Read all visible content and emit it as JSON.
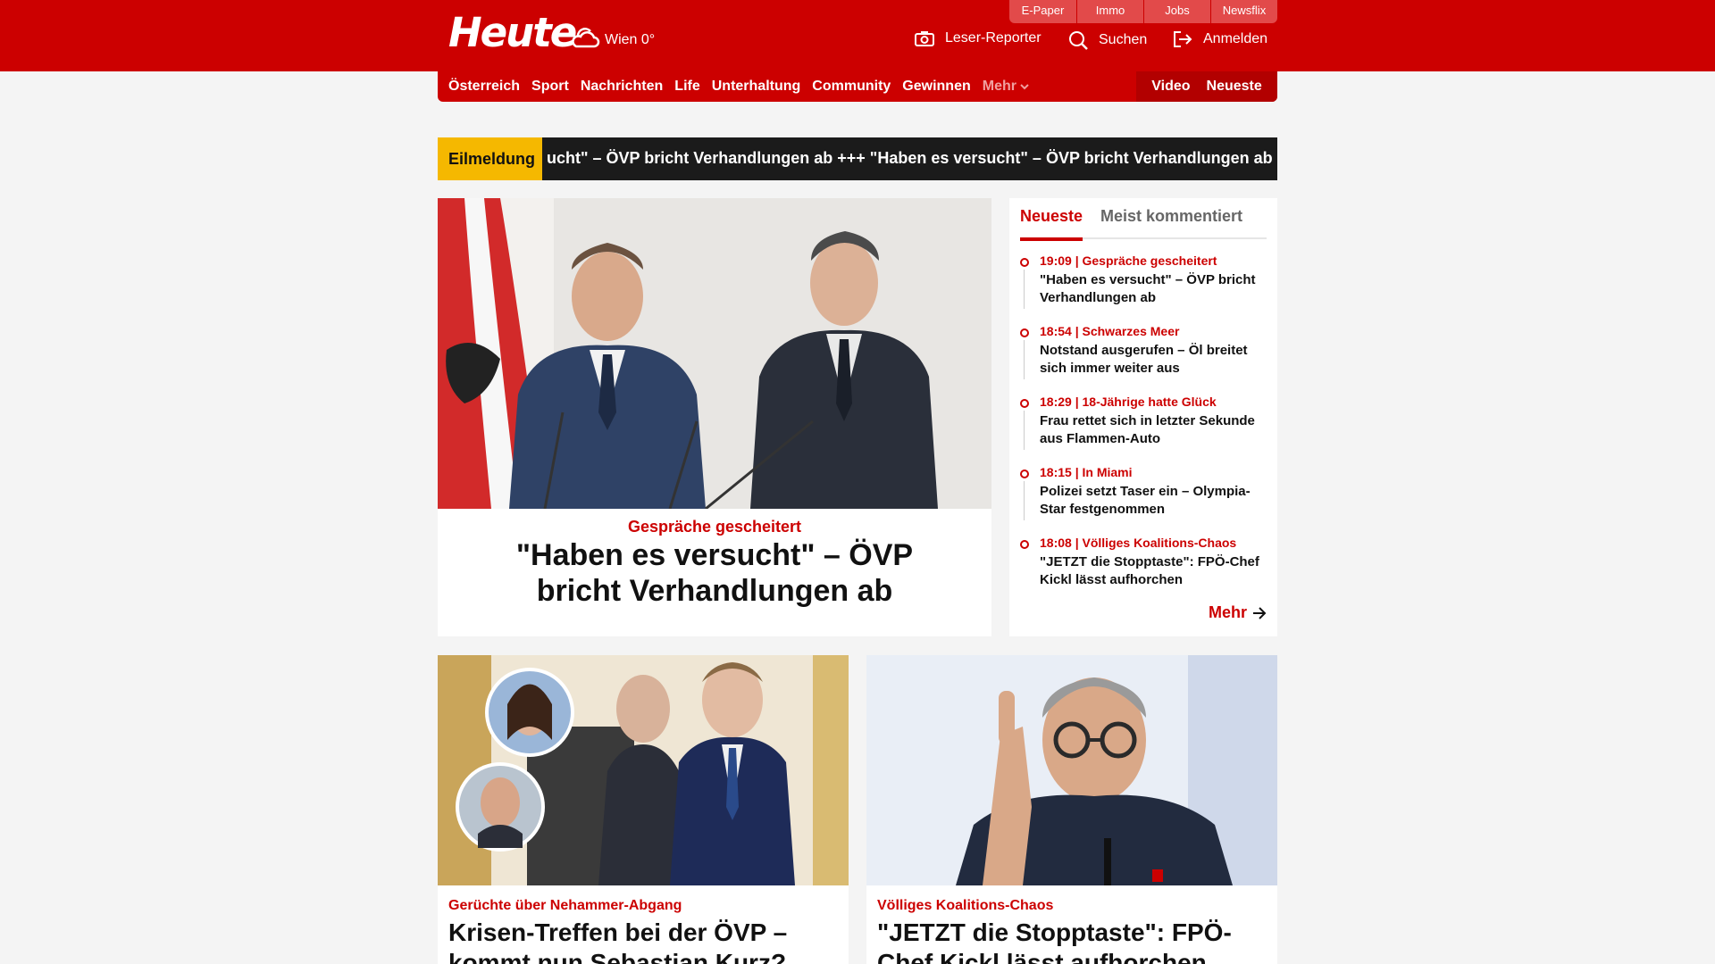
{
  "header": {
    "logo": "Heute",
    "weather": "Wien 0°",
    "toplinks": [
      "E-Paper",
      "Immo",
      "Jobs",
      "Newsflix"
    ],
    "leser_reporter": "Leser-Reporter",
    "search": "Suchen",
    "login": "Anmelden"
  },
  "nav": {
    "items": [
      "Österreich",
      "Sport",
      "Nachrichten",
      "Life",
      "Unterhaltung",
      "Community",
      "Gewinnen"
    ],
    "more": "Mehr",
    "video": "Video",
    "newest": "Neueste"
  },
  "breaking": {
    "label": "Eilmeldung",
    "text": "ucht\" – ÖVP bricht Verhandlungen ab  +++  \"Haben es versucht\" – ÖVP bricht Verhandlungen ab  ++"
  },
  "main_story": {
    "kicker": "Gespräche gescheitert",
    "title": "\"Haben es versucht\" – ÖVP bricht Verhandlungen ab"
  },
  "sidebar": {
    "tab_active": "Neueste",
    "tab_inactive": "Meist kommentiert",
    "items": [
      {
        "meta": "19:09 | Gespräche gescheitert",
        "title": "\"Haben es versucht\" – ÖVP bricht Verhandlungen ab"
      },
      {
        "meta": "18:54 | Schwarzes Meer",
        "title": "Notstand ausgerufen – Öl breitet sich immer weiter aus"
      },
      {
        "meta": "18:29 | 18-Jährige hatte Glück",
        "title": "Frau rettet sich in letzter Sekunde aus Flammen-Auto"
      },
      {
        "meta": "18:15 | In Miami",
        "title": "Polizei setzt Taser ein – Olympia-Star festgenommen"
      },
      {
        "meta": "18:08 | Völliges Koalitions-Chaos",
        "title": "\"JETZT die Stopptaste\": FPÖ-Chef Kickl lässt aufhorchen"
      }
    ],
    "more": "Mehr"
  },
  "cards": [
    {
      "kicker": "Gerüchte über Nehammer-Abgang",
      "title": "Krisen-Treffen bei der ÖVP – kommt nun Sebastian Kurz?"
    },
    {
      "kicker": "Völliges Koalitions-Chaos",
      "title": "\"JETZT die Stopptaste\": FPÖ-Chef Kickl lässt aufhorchen"
    }
  ]
}
